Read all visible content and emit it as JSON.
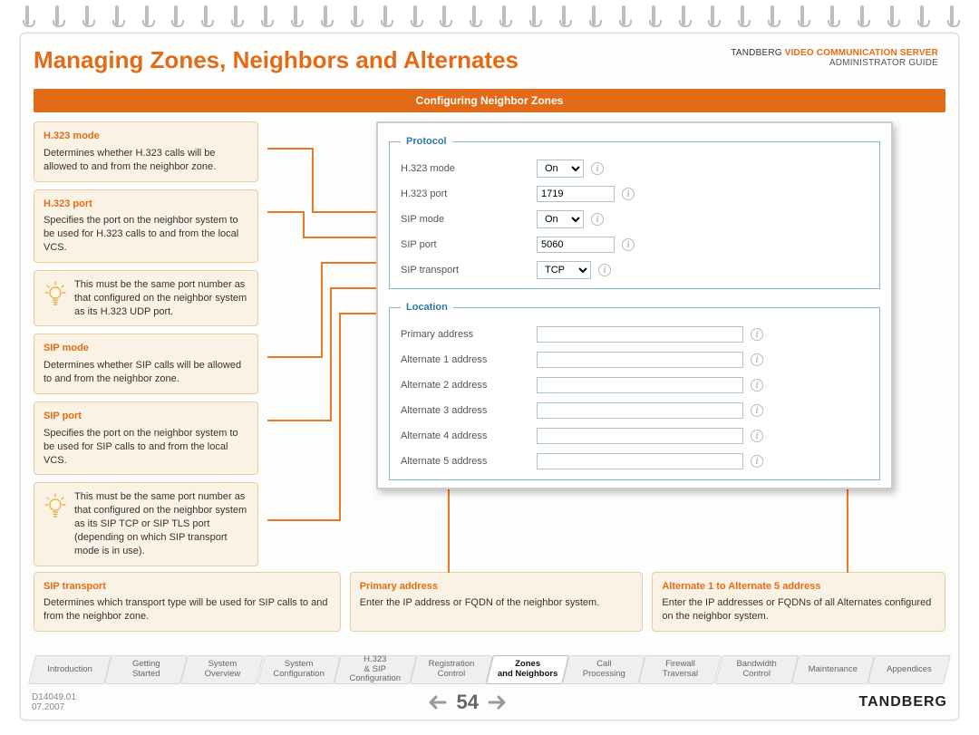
{
  "header": {
    "title": "Managing Zones, Neighbors and Alternates",
    "brand_line1_a": "TANDBERG ",
    "brand_line1_b": "VIDEO COMMUNICATION SERVER",
    "brand_line2": "ADMINISTRATOR GUIDE"
  },
  "section_bar": "Configuring Neighbor Zones",
  "notes": {
    "h323_mode": {
      "h": "H.323 mode",
      "t": "Determines whether H.323 calls will be allowed to and from the neighbor zone."
    },
    "h323_port": {
      "h": "H.323 port",
      "t": "Specifies the port on the neighbor system to be used for H.323 calls to and from the local VCS."
    },
    "h323_tip": "This must be the same port number as that configured on the neighbor system as its H.323 UDP port.",
    "sip_mode": {
      "h": "SIP mode",
      "t": "Determines whether SIP calls will be allowed to and from the neighbor zone."
    },
    "sip_port": {
      "h": "SIP port",
      "t": "Specifies the port on the neighbor system to be used for SIP calls to and from the local VCS."
    },
    "sip_tip": "This must be the same port number as that configured on the neighbor system as its SIP TCP or SIP TLS port (depending on which SIP transport mode is in use).",
    "sip_transport": {
      "h": "SIP transport",
      "t": "Determines which transport type will be used for SIP calls to and from the neighbor zone."
    },
    "primary_addr": {
      "h": "Primary address",
      "t": "Enter the IP address or FQDN of the neighbor system."
    },
    "alt_addr": {
      "h": "Alternate 1 to Alternate 5 address",
      "t": "Enter the IP addresses or FQDNs of all Alternates configured on the neighbor system."
    }
  },
  "form": {
    "protocol_legend": "Protocol",
    "location_legend": "Location",
    "rows": {
      "h323_mode": {
        "label": "H.323 mode",
        "value": "On"
      },
      "h323_port": {
        "label": "H.323 port",
        "value": "1719"
      },
      "sip_mode": {
        "label": "SIP mode",
        "value": "On"
      },
      "sip_port": {
        "label": "SIP port",
        "value": "5060"
      },
      "sip_trans": {
        "label": "SIP transport",
        "value": "TCP"
      },
      "primary": {
        "label": "Primary address",
        "value": ""
      },
      "alt1": {
        "label": "Alternate 1 address",
        "value": ""
      },
      "alt2": {
        "label": "Alternate 2 address",
        "value": ""
      },
      "alt3": {
        "label": "Alternate 3 address",
        "value": ""
      },
      "alt4": {
        "label": "Alternate 4 address",
        "value": ""
      },
      "alt5": {
        "label": "Alternate 5 address",
        "value": ""
      }
    }
  },
  "nav": {
    "items": [
      "Introduction",
      "Getting Started",
      "System Overview",
      "System Configuration",
      "H.323 & SIP Configuration",
      "Registration Control",
      "Zones and Neighbors",
      "Call Processing",
      "Firewall Traversal",
      "Bandwidth Control",
      "Maintenance",
      "Appendices"
    ],
    "active_index": 6
  },
  "footer": {
    "doc_id": "D14049.01",
    "date": "07.2007",
    "page": "54",
    "brand": "TANDBERG"
  }
}
